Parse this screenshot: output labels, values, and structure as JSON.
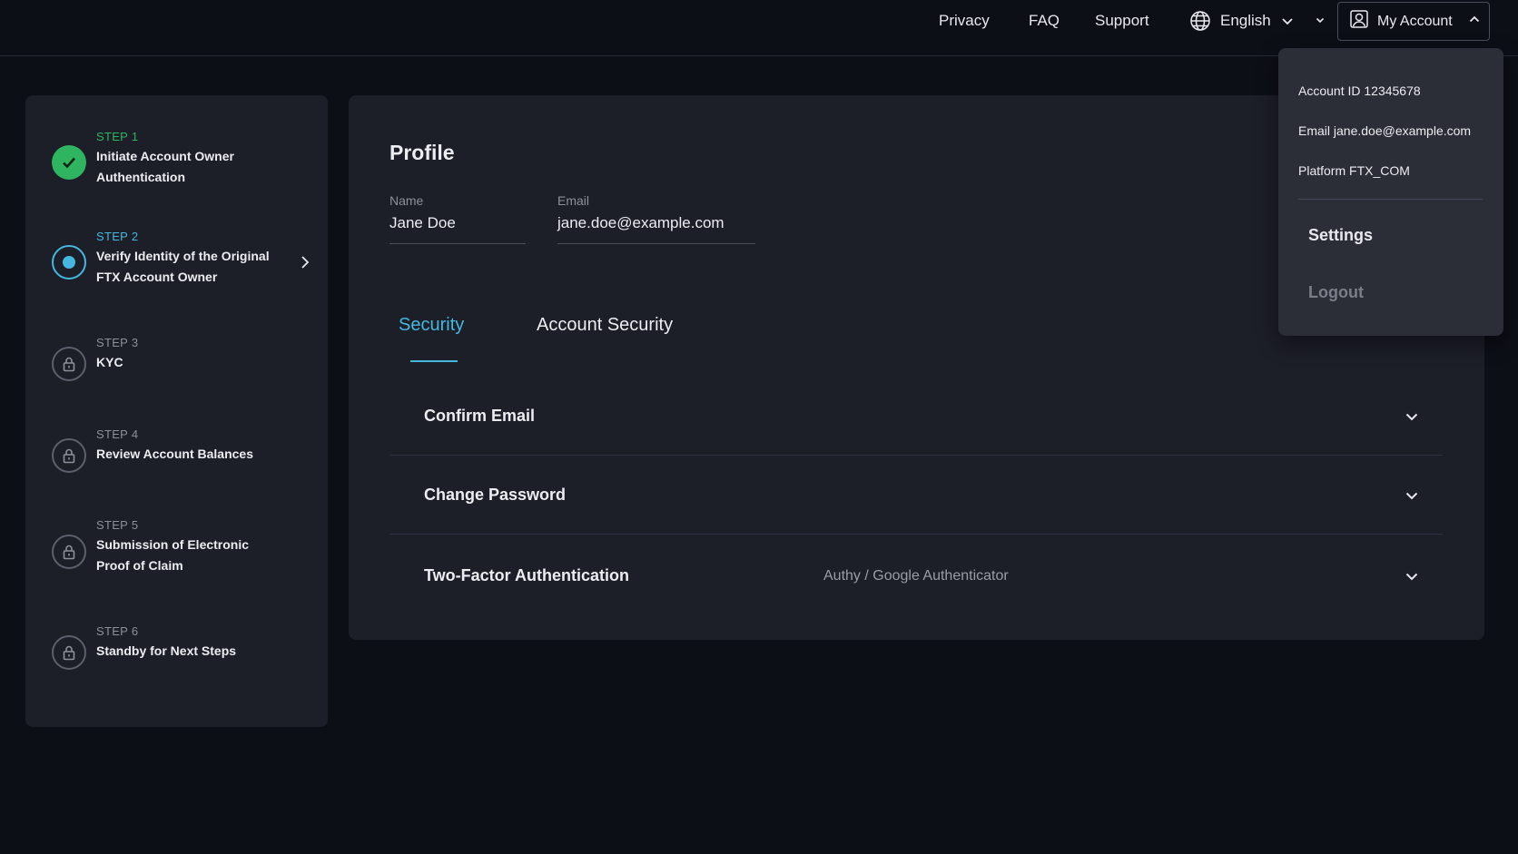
{
  "nav": {
    "privacy": "Privacy",
    "faq": "FAQ",
    "support": "Support",
    "language": "English",
    "account": "My Account"
  },
  "steps": [
    {
      "number": "STEP 1",
      "title": "Initiate Account Owner Authentication",
      "status": "done"
    },
    {
      "number": "STEP 2",
      "title": "Verify Identity of the Original FTX Account Owner",
      "status": "current"
    },
    {
      "number": "STEP 3",
      "title": "KYC",
      "status": "locked"
    },
    {
      "number": "STEP 4",
      "title": "Review Account Balances",
      "status": "locked"
    },
    {
      "number": "STEP 5",
      "title": "Submission of Electronic Proof of Claim",
      "status": "locked"
    },
    {
      "number": "STEP 6",
      "title": "Standby for Next Steps",
      "status": "locked"
    }
  ],
  "profile": {
    "title": "Profile",
    "name_label": "Name",
    "name_value": "Jane Doe",
    "email_label": "Email",
    "email_value": "jane.doe@example.com"
  },
  "tabs": [
    {
      "label": "Security",
      "active": true
    },
    {
      "label": "Account Security",
      "active": false
    }
  ],
  "security_rows": [
    {
      "label": "Confirm Email",
      "sub": ""
    },
    {
      "label": "Change Password",
      "sub": ""
    },
    {
      "label": "Two-Factor Authentication",
      "sub": "Authy / Google Authenticator"
    }
  ],
  "dropdown": {
    "account_id": "Account ID 12345678",
    "email": "Email jane.doe@example.com",
    "platform": "Platform FTX_COM",
    "settings": "Settings",
    "logout": "Logout"
  },
  "colors": {
    "background": "#0d0f17",
    "panel": "#1c1e28",
    "accent": "#44b8df",
    "success": "#2fb460"
  }
}
